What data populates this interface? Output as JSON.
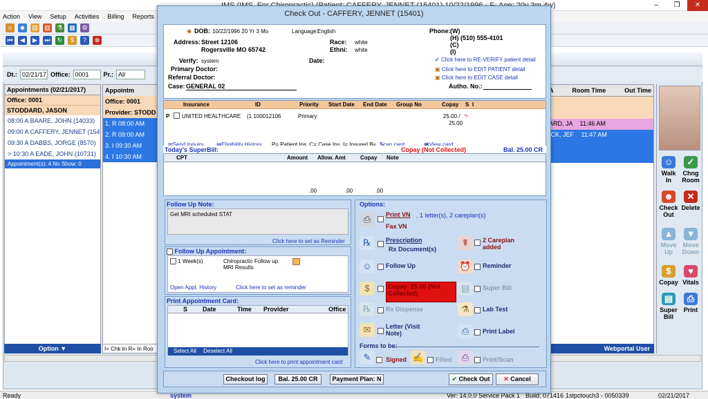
{
  "window": {
    "title": "IMS (IMS_For Chiropractic)   (Patient: CAFFERY, JENNET  (15401) 10/22/1996 - F- Age: 20y 3m 4w)"
  },
  "menu": [
    "Action",
    "View",
    "Setup",
    "Activities",
    "Billing",
    "Reports"
  ],
  "filter": {
    "dt_label": "Dt.:",
    "date": "02/21/17",
    "office_label": "Office:",
    "office": "0001",
    "pr_label": "Pr.:",
    "pr": "All"
  },
  "left_panel": {
    "header": "Appointments (02/21/2017)",
    "office": "Office: 0001",
    "provider": "STODDARD, JASON",
    "rows": [
      {
        "text": "08:00 A   BAARE, JOHN (14033)"
      },
      {
        "text": "09:00 A   CAFFERY, JENNET (154"
      },
      {
        "text": "09:30 A   DABBS, JORGE (8570)"
      },
      {
        "text": "> 10:30 A   EADE, JOHN (10731)"
      }
    ],
    "summary": "Appointment(s): 4   No Show: 0",
    "footer": "Option"
  },
  "mid_panel": {
    "header": "Appointm",
    "office": "Office: 0001",
    "provider": "Provider: STODD",
    "rows": [
      "1.   R  08:00 AM",
      "2.   R  09:00 AM",
      "3.   I   09:30 AM",
      "4.   I   10:30 AM"
    ],
    "footer": "I= Chk In  R= In Roo"
  },
  "right_grid": {
    "col_a": "A",
    "col_room": "Room Time",
    "col_out": "Out Time",
    "rows": [
      {
        "name": "ARD, JA",
        "time": "11:46 AM"
      },
      {
        "name": "ICK, JEF",
        "time": "11:47 AM"
      }
    ],
    "footer": "Webportal User"
  },
  "sidebar": {
    "walk_in": "Walk In",
    "chng_room": "Chng Room",
    "check_out": "Check Out",
    "delete": "Delete",
    "move_up": "Move Up",
    "move_down": "Move Down",
    "copay": "Copay",
    "vitals": "Vitals",
    "super_bill": "Super Bill",
    "print": "Print"
  },
  "dialog": {
    "title": "Check Out - CAFFERY, JENNET  (15401)",
    "patient": {
      "dob_label": "DOB:",
      "dob": "10/22/1996  20 Yr 3 Mo",
      "language_label": "Language:",
      "language": "English",
      "phone_label": "Phone:",
      "phone_w": "(W)",
      "phone_h": "(H)  (510) 555-4101",
      "phone_c": "(C)",
      "phone_i": "(I)",
      "address_label": "Address:",
      "street": "Street 12106",
      "city": "Rogersville  MO  65742",
      "race_label": "Race:",
      "race": "white",
      "ethni_label": "Ethni:",
      "ethni": "white",
      "verify_label": "Verify:",
      "verify": "system",
      "date_label": "Date:",
      "primary_doctor_label": "Primary Doctor:",
      "referral_doctor_label": "Referral Doctor:",
      "case_label": "Case:",
      "case": "GENERAL 02",
      "autho_label": "Autho. No.:",
      "reverify_link": "Click here to RE-VERIFY patient detail",
      "edit_patient_link": "Click here to EDIT PATIENT detail",
      "edit_case_link": "Click here to EDIT CASE detail"
    },
    "insurance": {
      "headers": [
        "Insurance",
        "ID",
        "Priority",
        "Start Date",
        "End Date",
        "Group No",
        "Copay",
        "S",
        "I"
      ],
      "row": {
        "flag": "P",
        "insurance": "UNITED HEALTHCARE",
        "id": "(1 100012106",
        "priority": "Primary",
        "copay": "25.00 /",
        "copay2": "25.00"
      },
      "send_inquiry": "Send Inquiry",
      "eligibility_history": "Eligibility History",
      "legend": "P= Patient Ins. C= Case Ins. I= Insured By",
      "scan_card": "Scan card",
      "view_card": "View card"
    },
    "superbill": {
      "title": "Today's SuperBill:",
      "copay_status": "Copay (Not Collected)",
      "balance": "Bal. 25.00 CR",
      "headers": [
        "CPT",
        "Amount",
        "Allow. Amt",
        "Copay",
        "Note"
      ],
      "totals": [
        ".00",
        ".00",
        ".00"
      ]
    },
    "followup_note": {
      "label": "Follow Up Note:",
      "text": "Get MRI scheduled STAT",
      "reminder_link": "Click here to set as Reminder"
    },
    "followup_appt": {
      "label": "Follow Up Appointment:",
      "duration": "1  Week(s)",
      "desc1": "Chiropractic Follow up",
      "desc2": "MRI Results",
      "history_link": "Open Appt. History",
      "reminder_link": "Click here to set as reminder"
    },
    "print_card": {
      "label": "Print Appointment Card:",
      "headers": [
        "S",
        "Date",
        "Time",
        "Provider",
        "Office"
      ],
      "select_all": "Select All",
      "deselect_all": "Deselect All",
      "print_link": "Click here to print appointment card"
    },
    "options": {
      "label": "Options:",
      "print_vn": "Print VN",
      "print_vn_detail": ", 1 letter(s), 2 careplan(s)",
      "fax_vn": "Fax VN",
      "prescription": "Prescription",
      "rx_docs": "Rx Document(s)",
      "careplan": "2 Careplan added",
      "follow_up": "Follow Up",
      "reminder": "Reminder",
      "copay": "Copay: 25.00 (Not Collected)",
      "super_bill": "Super Bill",
      "rx_dispense": "Rx Dispense",
      "lab_test": "Lab Test",
      "letter": "Letter (Visit Note)",
      "print_label": "Print Label",
      "forms_label": "Forms to be:",
      "signed": "Signed",
      "filled": "Filled",
      "print_scan": "Print/Scan"
    },
    "bottom": {
      "checkout_log": "Checkout log",
      "balance": "Bal. 25.00 CR",
      "payment_plan": "Payment Plan: N",
      "check_out": "Check Out",
      "cancel": "Cancel"
    }
  },
  "status": {
    "ready": "Ready",
    "user": "system",
    "version": "Ver: 14.0.0 Service Pack 1",
    "build": "Build: 071416",
    "station": "1stpctouch3 - 0050339",
    "date": "02/21/2017"
  },
  "colors": {
    "dialog_bg": "#bdd6ef",
    "insurance_header": "#f2c79c",
    "copay_alert": "#e01010",
    "link": "#1a33b8"
  }
}
